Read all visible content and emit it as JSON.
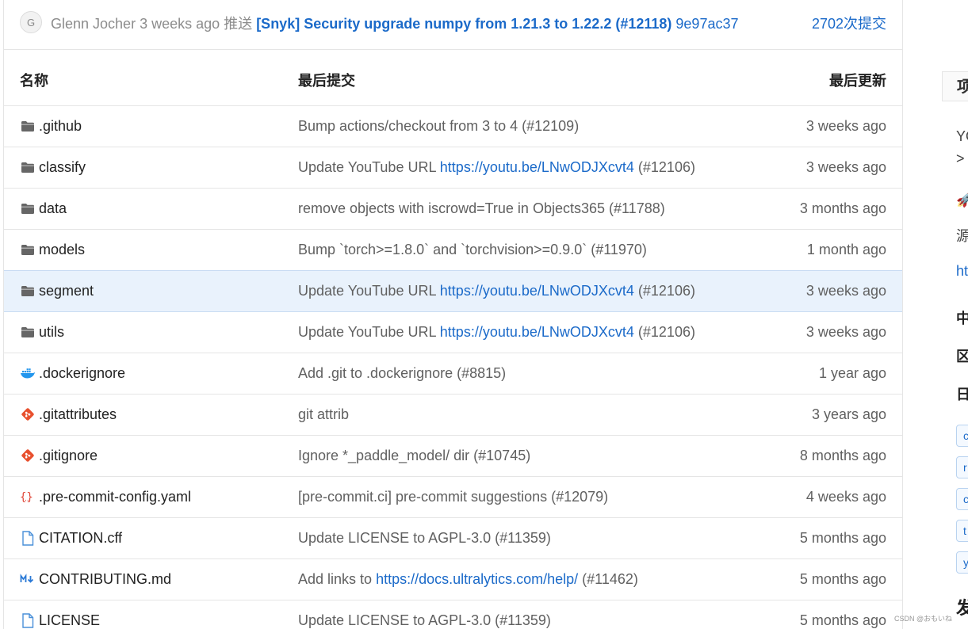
{
  "last_commit": {
    "avatar_letter": "G",
    "author": "Glenn Jocher",
    "time": "3 weeks ago",
    "action": "推送",
    "message": "[Snyk] Security upgrade numpy from 1.21.3 to 1.22.2 (#12118)",
    "sha": "9e97ac37",
    "count": "2702次提交"
  },
  "table": {
    "headers": {
      "name": "名称",
      "commit": "最后提交",
      "time": "最后更新"
    },
    "rows": [
      {
        "icon": "folder-icon",
        "name": ".github",
        "commit": "Bump actions/checkout from 3 to 4 (#12109)",
        "link": "",
        "suffix": "",
        "time": "3 weeks ago"
      },
      {
        "icon": "folder-icon",
        "name": "classify",
        "commit": "Update YouTube URL ",
        "link": "https://youtu.be/LNwODJXcvt4",
        "suffix": " (#12106)",
        "time": "3 weeks ago"
      },
      {
        "icon": "folder-icon",
        "name": "data",
        "commit": "remove objects with iscrowd=True in Objects365 (#11788)",
        "link": "",
        "suffix": "",
        "time": "3 months ago"
      },
      {
        "icon": "folder-icon",
        "name": "models",
        "commit": "Bump `torch>=1.8.0` and `torchvision>=0.9.0` (#11970)",
        "link": "",
        "suffix": "",
        "time": "1 month ago"
      },
      {
        "icon": "folder-icon",
        "name": "segment",
        "commit": "Update YouTube URL ",
        "link": "https://youtu.be/LNwODJXcvt4",
        "suffix": " (#12106)",
        "time": "3 weeks ago",
        "highlight": true
      },
      {
        "icon": "folder-icon",
        "name": "utils",
        "commit": "Update YouTube URL ",
        "link": "https://youtu.be/LNwODJXcvt4",
        "suffix": " (#12106)",
        "time": "3 weeks ago"
      },
      {
        "icon": "docker-icon",
        "name": ".dockerignore",
        "commit": "Add .git to .dockerignore (#8815)",
        "link": "",
        "suffix": "",
        "time": "1 year ago"
      },
      {
        "icon": "git-icon",
        "name": ".gitattributes",
        "commit": "git attrib",
        "link": "",
        "suffix": "",
        "time": "3 years ago"
      },
      {
        "icon": "git-icon",
        "name": ".gitignore",
        "commit": "Ignore *_paddle_model/ dir (#10745)",
        "link": "",
        "suffix": "",
        "time": "8 months ago"
      },
      {
        "icon": "yaml-icon",
        "name": ".pre-commit-config.yaml",
        "commit": "[pre-commit.ci] pre-commit suggestions (#12079)",
        "link": "",
        "suffix": "",
        "time": "4 weeks ago"
      },
      {
        "icon": "file-icon",
        "name": "CITATION.cff",
        "commit": "Update LICENSE to AGPL-3.0 (#11359)",
        "link": "",
        "suffix": "",
        "time": "5 months ago"
      },
      {
        "icon": "markdown-icon",
        "name": "CONTRIBUTING.md",
        "commit": "Add links to ",
        "link": "https://docs.ultralytics.com/help/",
        "suffix": " (#11462)",
        "time": "5 months ago"
      },
      {
        "icon": "file-icon",
        "name": "LICENSE",
        "commit": "Update LICENSE to AGPL-3.0 (#11359)",
        "link": "",
        "suffix": "",
        "time": "5 months ago"
      }
    ]
  },
  "sidebar": {
    "title": "项",
    "lines": [
      "YO",
      ">",
      "源",
      "ht",
      "中",
      "区",
      "日"
    ],
    "tags": [
      "c",
      "r",
      "c",
      "t",
      "y"
    ],
    "bottom": "发"
  },
  "watermark": "CSDN @おもいね"
}
